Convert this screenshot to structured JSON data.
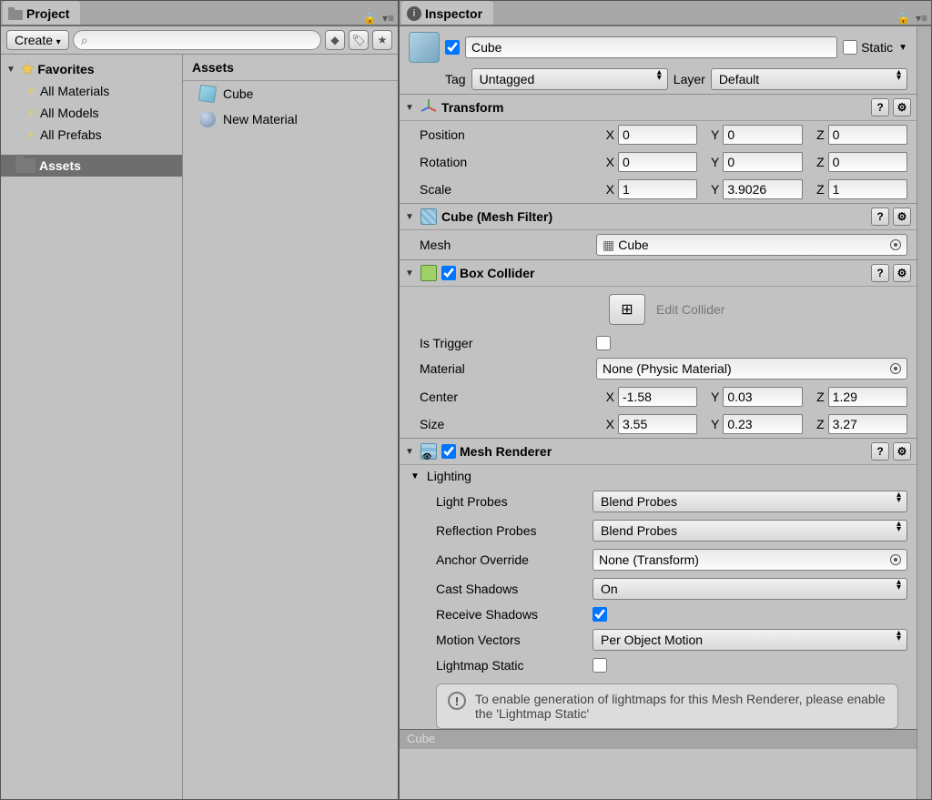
{
  "project": {
    "tab_label": "Project",
    "create_label": "Create",
    "favorites_label": "Favorites",
    "fav_items": [
      "All Materials",
      "All Models",
      "All Prefabs"
    ],
    "assets_tree_label": "Assets",
    "right_header": "Assets",
    "assets": [
      {
        "name": "Cube",
        "selected": true,
        "icon": "cube"
      },
      {
        "name": "New Material",
        "selected": false,
        "icon": "sphere"
      }
    ]
  },
  "inspector": {
    "tab_label": "Inspector",
    "go_name": "Cube",
    "static_label": "Static",
    "tag_label": "Tag",
    "tag_value": "Untagged",
    "layer_label": "Layer",
    "layer_value": "Default",
    "transform": {
      "title": "Transform",
      "position_label": "Position",
      "position": {
        "x": "0",
        "y": "0",
        "z": "0"
      },
      "rotation_label": "Rotation",
      "rotation": {
        "x": "0",
        "y": "0",
        "z": "0"
      },
      "scale_label": "Scale",
      "scale": {
        "x": "1",
        "y": "3.9026",
        "z": "1"
      }
    },
    "meshfilter": {
      "title": "Cube (Mesh Filter)",
      "mesh_label": "Mesh",
      "mesh_value": "Cube"
    },
    "boxcollider": {
      "title": "Box Collider",
      "edit_label": "Edit Collider",
      "is_trigger_label": "Is Trigger",
      "material_label": "Material",
      "material_value": "None (Physic Material)",
      "center_label": "Center",
      "center": {
        "x": "-1.58",
        "y": "0.03",
        "z": "1.29"
      },
      "size_label": "Size",
      "size": {
        "x": "3.55",
        "y": "0.23",
        "z": "3.27"
      }
    },
    "renderer": {
      "title": "Mesh Renderer",
      "lighting_label": "Lighting",
      "light_probes_label": "Light Probes",
      "light_probes_value": "Blend Probes",
      "reflection_probes_label": "Reflection Probes",
      "reflection_probes_value": "Blend Probes",
      "anchor_override_label": "Anchor Override",
      "anchor_override_value": "None (Transform)",
      "cast_shadows_label": "Cast Shadows",
      "cast_shadows_value": "On",
      "receive_shadows_label": "Receive Shadows",
      "motion_vectors_label": "Motion Vectors",
      "motion_vectors_value": "Per Object Motion",
      "lightmap_static_label": "Lightmap Static",
      "info_text": "To enable generation of lightmaps for this Mesh Renderer, please enable the 'Lightmap Static'"
    }
  }
}
